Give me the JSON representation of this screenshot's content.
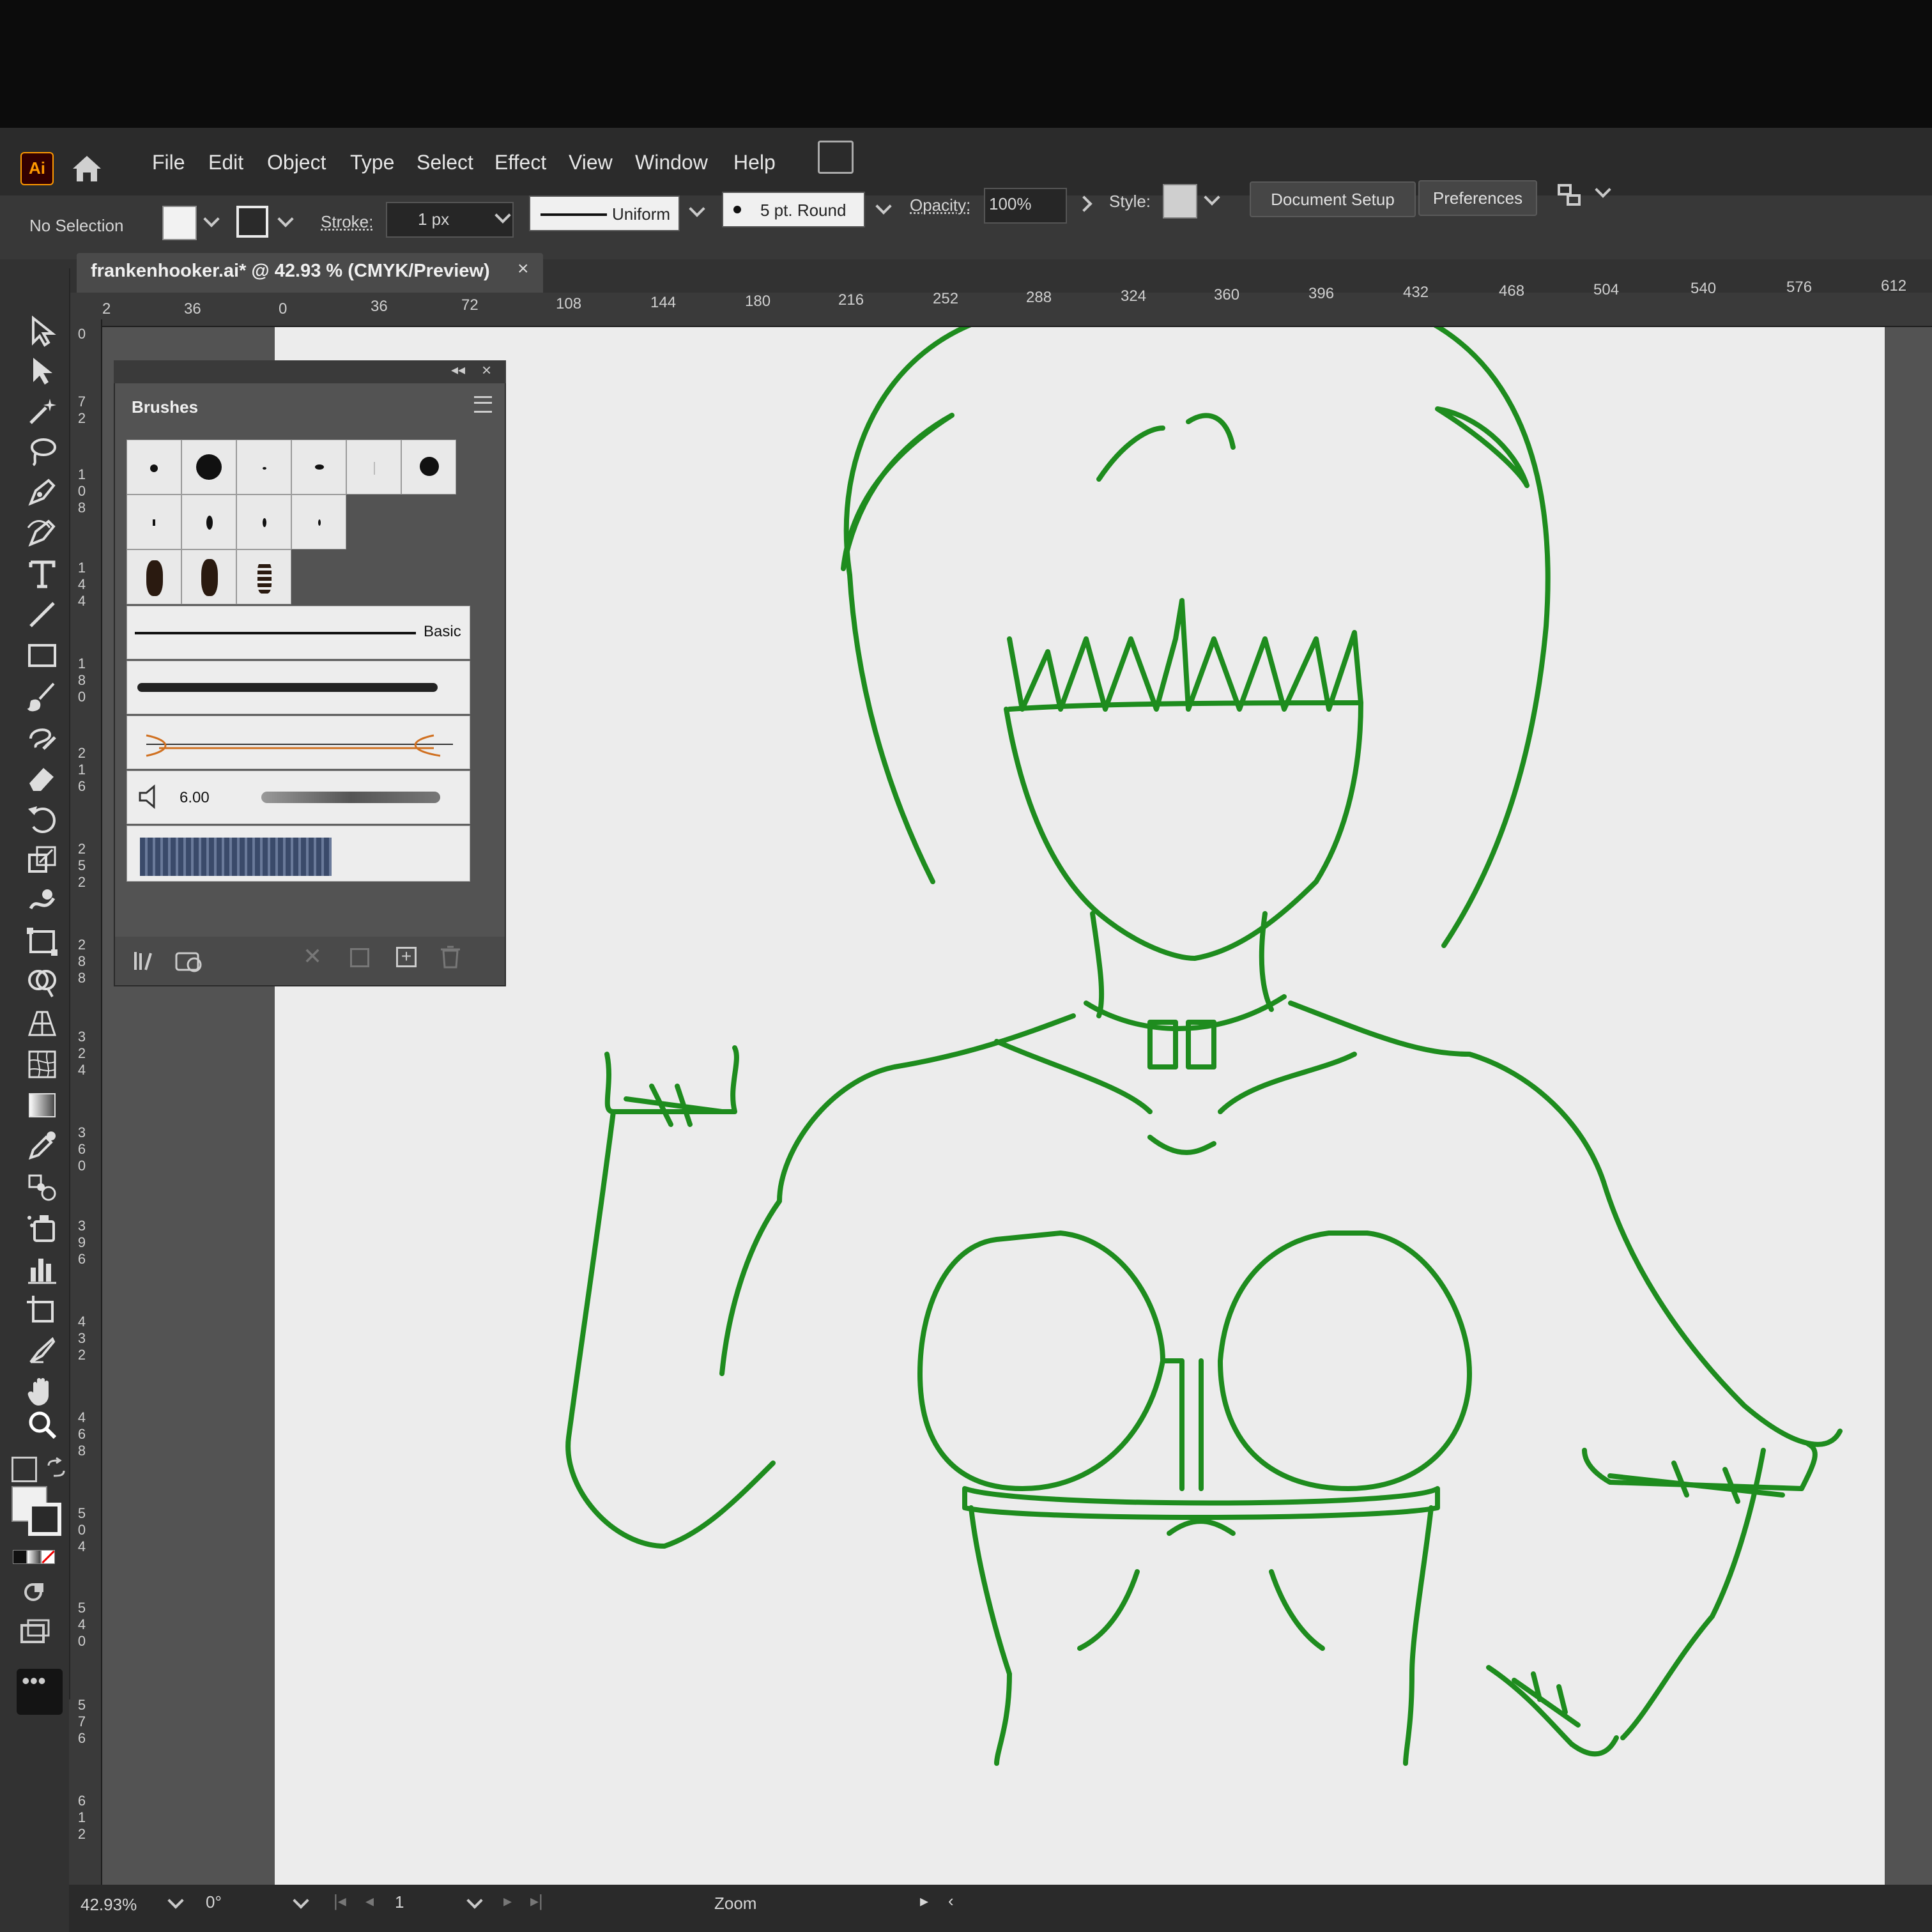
{
  "app": {
    "logo_text": "Ai",
    "menu": [
      "File",
      "Edit",
      "Object",
      "Type",
      "Select",
      "Effect",
      "View",
      "Window",
      "Help"
    ]
  },
  "control_bar": {
    "selection_label": "No Selection",
    "stroke_label": "Stroke:",
    "stroke_value": "1 px",
    "profile_label": "Uniform",
    "brush_label": "5 pt. Round",
    "opacity_label": "Opacity:",
    "opacity_value": "100%",
    "style_label": "Style:",
    "document_setup": "Document Setup",
    "preferences": "Preferences"
  },
  "document": {
    "tab_title": "frankenhooker.ai* @ 42.93 % (CMYK/Preview)",
    "tab_close": "×"
  },
  "rulers": {
    "top": [
      "2",
      "36",
      "36",
      "72",
      "108",
      "144",
      "180",
      "216",
      "252",
      "288",
      "324",
      "360",
      "396",
      "432",
      "468",
      "504",
      "540",
      "576",
      "612"
    ],
    "top_origin": "0",
    "left": [
      "0",
      "72",
      "108",
      "144",
      "180",
      "216",
      "252",
      "288",
      "324",
      "360",
      "396",
      "432",
      "468",
      "504",
      "540",
      "576",
      "612"
    ]
  },
  "brushes_panel": {
    "title": "Brushes",
    "rows": {
      "basic_label": "Basic",
      "bristle_size": "6.00"
    }
  },
  "status_bar": {
    "zoom": "42.93%",
    "rotation": "0°",
    "artboard": "1",
    "mode": "Zoom"
  },
  "colors": {
    "artwork_stroke": "#1e8c1e",
    "menubar_bg": "#2b2b2b",
    "panel_bg": "#535353",
    "artboard_bg": "#ececec"
  },
  "icons": [
    "home-icon",
    "arrange-documents-icon",
    "selection-tool-icon",
    "direct-selection-tool-icon",
    "magic-wand-icon",
    "lasso-icon",
    "pen-tool-icon",
    "curvature-tool-icon",
    "type-tool-icon",
    "line-tool-icon",
    "rectangle-tool-icon",
    "paintbrush-tool-icon",
    "shaper-tool-icon",
    "eraser-tool-icon",
    "rotate-tool-icon",
    "scale-tool-icon",
    "warp-tool-icon",
    "free-transform-icon",
    "shape-builder-icon",
    "perspective-grid-icon",
    "mesh-tool-icon",
    "gradient-tool-icon",
    "eyedropper-icon",
    "blend-tool-icon",
    "symbol-sprayer-icon",
    "column-graph-icon",
    "artboard-tool-icon",
    "slice-tool-icon",
    "hand-tool-icon",
    "zoom-tool-icon"
  ]
}
